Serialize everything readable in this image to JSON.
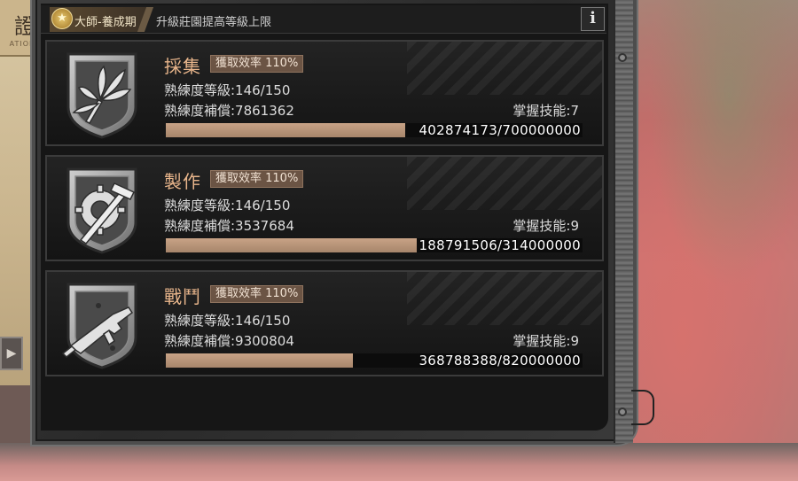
{
  "left_panel": {
    "title": "證",
    "subtitle": "ATION",
    "button_glyph": "▶"
  },
  "header": {
    "rank_label": "大師-養成期",
    "rank_icon": "star-icon",
    "subtitle": "升級莊園提高等級上限",
    "info_label": "i"
  },
  "skills": [
    {
      "icon": "herb-emblem-icon",
      "title": "採集",
      "efficiency": "獲取效率 110%",
      "level": "熟練度等級:146/150",
      "compensation": "熟練度補償:7861362",
      "mastery": "掌握技能:7",
      "progress_text": "402874173/700000000",
      "progress": 0.5755
    },
    {
      "icon": "gear-hammer-emblem-icon",
      "title": "製作",
      "efficiency": "獲取效率 110%",
      "level": "熟練度等級:146/150",
      "compensation": "熟練度補償:3537684",
      "mastery": "掌握技能:9",
      "progress_text": "188791506/314000000",
      "progress": 0.6012
    },
    {
      "icon": "gun-emblem-icon",
      "title": "戰鬥",
      "efficiency": "獲取效率 110%",
      "level": "熟練度等級:146/150",
      "compensation": "熟練度補償:9300804",
      "mastery": "掌握技能:9",
      "progress_text": "368788388/820000000",
      "progress": 0.4497
    }
  ],
  "colors": {
    "title": "#e8b58b",
    "bar_fill": "#c8a386",
    "efficiency_bg": "#6b5444"
  }
}
